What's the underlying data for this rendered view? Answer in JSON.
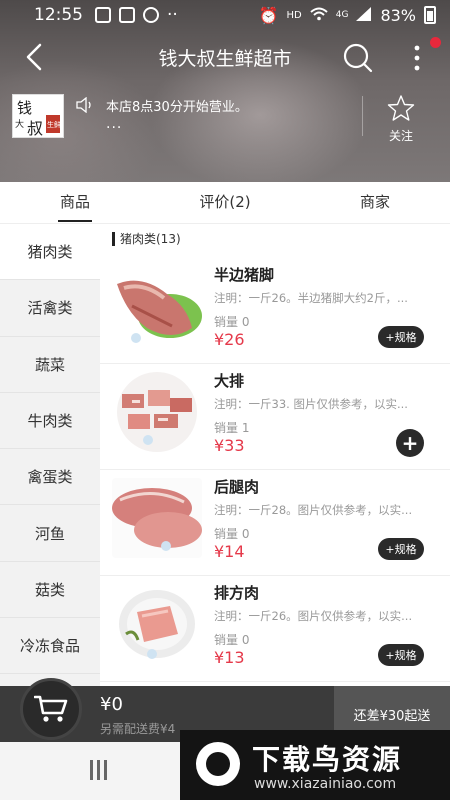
{
  "status_bar": {
    "time": "12:55",
    "dots": "··",
    "network": "HD",
    "signal": "4G",
    "battery": "83%"
  },
  "header": {
    "title": "钱大叔生鲜超市"
  },
  "store": {
    "logo_text": "钱大叔",
    "notice": "本店8点30分开始营业。",
    "notice_more": "...",
    "follow_label": "关注"
  },
  "tabs": [
    {
      "label": "商品"
    },
    {
      "label": "评价(2)"
    },
    {
      "label": "商家"
    }
  ],
  "categories": [
    "猪肉类",
    "活禽类",
    "蔬菜",
    "牛肉类",
    "禽蛋类",
    "河鱼",
    "菇类",
    "冷冻食品"
  ],
  "section_title": "猪肉类(13)",
  "products": [
    {
      "name": "半边猪脚",
      "note": "注明：一斤26。半边猪脚大约2斤，...",
      "sales": "销量 0",
      "price": "¥26",
      "action": "+规格"
    },
    {
      "name": "大排",
      "note": "注明：一斤33. 图片仅供参考，以实...",
      "sales": "销量 1",
      "price": "¥33",
      "action": "+"
    },
    {
      "name": "后腿肉",
      "note": "注明：一斤28。图片仅供参考，以实...",
      "sales": "销量 0",
      "price": "¥14",
      "action": "+规格"
    },
    {
      "name": "排方肉",
      "note": "注明：一斤26。图片仅供参考，以实...",
      "sales": "销量 0",
      "price": "¥13",
      "action": "+规格"
    }
  ],
  "cart": {
    "total": "¥0",
    "delivery_fee": "另需配送费¥4",
    "checkout": "还差¥30起送"
  },
  "watermark": {
    "title": "下载鸟资源",
    "url": "www.xiazainiao.com"
  },
  "colors": {
    "price": "#e5394a",
    "badge": "#e8283c",
    "cart_bar": "#3b3b3b"
  }
}
